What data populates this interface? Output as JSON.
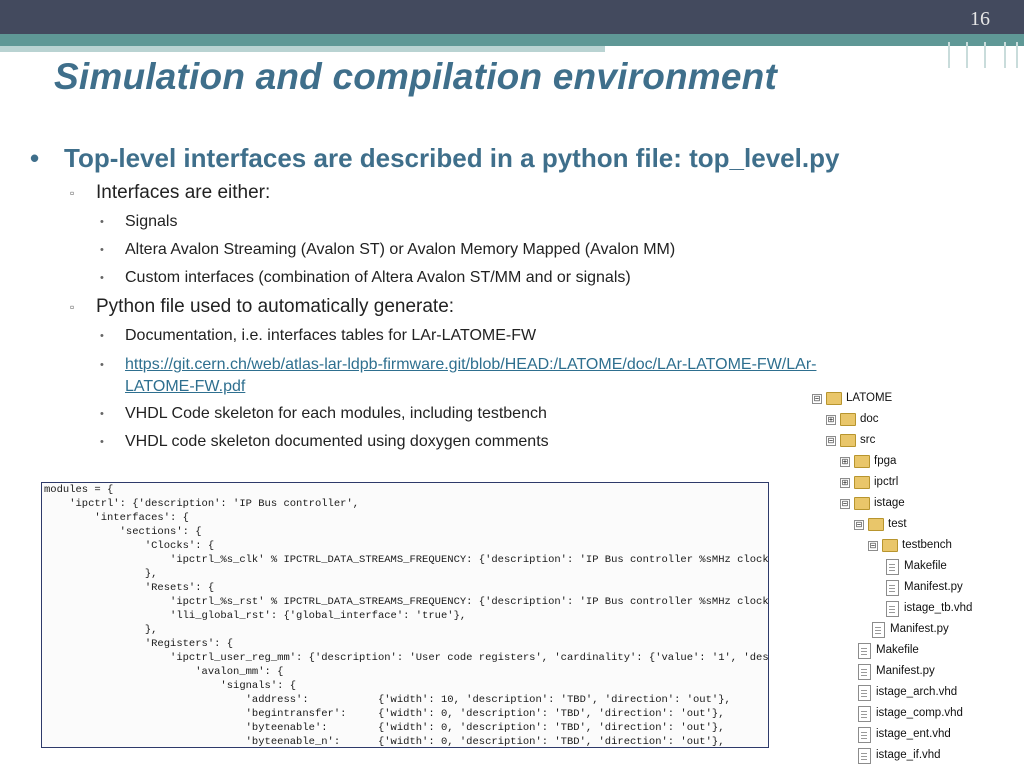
{
  "slide": {
    "number": "16",
    "title": "Simulation and compilation environment"
  },
  "bullets": {
    "main": "Top-level interfaces are described in a python file: top_level.py",
    "sub1": "Interfaces are either:",
    "sub1_items": [
      "Signals",
      "Altera Avalon Streaming (Avalon ST) or Avalon Memory Mapped (Avalon MM)",
      "Custom interfaces (combination of Altera Avalon ST/MM and or signals)"
    ],
    "sub2": "Python file used to automatically generate:",
    "sub2_items": [
      "Documentation, i.e. interfaces tables for LAr-LATOME-FW",
      "https://git.cern.ch/web/atlas-lar-ldpb-firmware.git/blob/HEAD:/LATOME/doc/LAr-LATOME-FW/LAr-LATOME-FW.pdf",
      "VHDL Code skeleton for each modules, including testbench",
      "VHDL code skeleton documented using doxygen comments"
    ],
    "link_line1": "https://git.cern.ch/web/atlas-lar-ldpb-firmware.git/blob/HEAD:/LATOME/doc/LAr-LATOME-FW/LAr-",
    "link_line2": "LATOME-FW.pdf"
  },
  "code": [
    "modules = {",
    "    'ipctrl': {'description': 'IP Bus controller',",
    "        'interfaces': {",
    "            'sections': {",
    "                'Clocks': {",
    "                    'ipctrl_%s_clk' % IPCTRL_DATA_STREAMS_FREQUENCY: {'description': 'IP Bus controller %sMHz clock'",
    "                },",
    "                'Resets': {",
    "                    'ipctrl_%s_rst' % IPCTRL_DATA_STREAMS_FREQUENCY: {'description': 'IP Bus controller %sMHz clock",
    "                    'lli_global_rst': {'global_interface': 'true'},",
    "                },",
    "                'Registers': {",
    "                    'ipctrl_user_reg_mm': {'description': 'User code registers', 'cardinality': {'value': '1', 'desc",
    "                        'avalon_mm': {",
    "                            'signals': {",
    "                                'address':           {'width': 10, 'description': 'TBD', 'direction': 'out'},",
    "                                'begintransfer':     {'width': 0, 'description': 'TBD', 'direction': 'out'},",
    "                                'byteenable':        {'width': 0, 'description': 'TBD', 'direction': 'out'},",
    "                                'byteenable_n':      {'width': 0, 'description': 'TBD', 'direction': 'out'},"
  ],
  "tree": [
    {
      "label": "LATOME",
      "type": "folder",
      "expander": "⊟",
      "depth": 0
    },
    {
      "label": "doc",
      "type": "folder",
      "expander": "⊞",
      "depth": 1
    },
    {
      "label": "src",
      "type": "folder",
      "expander": "⊟",
      "depth": 1
    },
    {
      "label": "fpga",
      "type": "folder",
      "expander": "⊞",
      "depth": 2
    },
    {
      "label": "ipctrl",
      "type": "folder",
      "expander": "⊞",
      "depth": 2
    },
    {
      "label": "istage",
      "type": "folder",
      "expander": "⊟",
      "depth": 2
    },
    {
      "label": "test",
      "type": "folder",
      "expander": "⊟",
      "depth": 3
    },
    {
      "label": "testbench",
      "type": "folder",
      "expander": "⊟",
      "depth": 4
    },
    {
      "label": "Makefile",
      "type": "file",
      "expander": "",
      "depth": 5
    },
    {
      "label": "Manifest.py",
      "type": "file",
      "expander": "",
      "depth": 5
    },
    {
      "label": "istage_tb.vhd",
      "type": "file",
      "expander": "",
      "depth": 5
    },
    {
      "label": "Manifest.py",
      "type": "file",
      "expander": "",
      "depth": 4
    },
    {
      "label": "Makefile",
      "type": "file",
      "expander": "",
      "depth": 3
    },
    {
      "label": "Manifest.py",
      "type": "file",
      "expander": "",
      "depth": 3
    },
    {
      "label": "istage_arch.vhd",
      "type": "file",
      "expander": "",
      "depth": 3
    },
    {
      "label": "istage_comp.vhd",
      "type": "file",
      "expander": "",
      "depth": 3
    },
    {
      "label": "istage_ent.vhd",
      "type": "file",
      "expander": "",
      "depth": 3
    },
    {
      "label": "istage_if.vhd",
      "type": "file",
      "expander": "",
      "depth": 3
    }
  ]
}
